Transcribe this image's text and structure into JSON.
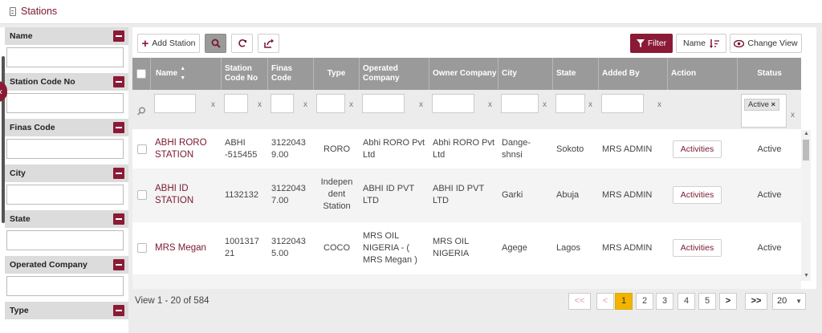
{
  "page": {
    "title": "Stations"
  },
  "sidebar": {
    "filters": [
      {
        "label": "Name"
      },
      {
        "label": "Station Code No"
      },
      {
        "label": "Finas Code"
      },
      {
        "label": "City"
      },
      {
        "label": "State"
      },
      {
        "label": "Operated Company"
      },
      {
        "label": "Type"
      }
    ]
  },
  "toolbar": {
    "add_label": "Add Station",
    "filter_label": "Filter",
    "sort_label": "Name",
    "view_label": "Change View"
  },
  "table": {
    "columns": [
      "Name",
      "Station Code No",
      "Finas Code",
      "Type",
      "Operated Company",
      "Owner Company",
      "City",
      "State",
      "Added By",
      "Action",
      "Status"
    ],
    "filter_clear": "x",
    "status_filter_chip": "Active",
    "rows": [
      {
        "name": "ABHI RORO STATION",
        "code": "ABHI -515455",
        "finas": "3122043 9.00",
        "type": "RORO",
        "operated": "Abhi RORO Pvt Ltd",
        "owner": "Abhi RORO Pvt Ltd",
        "city": "Dange-shnsi",
        "state": "Sokoto",
        "added_by": "MRS ADMIN",
        "action": "Activities",
        "status": "Active"
      },
      {
        "name": "ABHI ID STATION",
        "code": "1132132",
        "finas": "3122043 7.00",
        "type": "Indepen dent Station",
        "operated": "ABHI ID PVT LTD",
        "owner": "ABHI ID PVT LTD",
        "city": "Garki",
        "state": "Abuja",
        "added_by": "MRS ADMIN",
        "action": "Activities",
        "status": "Active"
      },
      {
        "name": "MRS Megan",
        "code": "1001317 21",
        "finas": "3122043 5.00",
        "type": "COCO",
        "operated": "MRS OIL NIGERIA - ( MRS Megan )",
        "owner": "MRS OIL NIGERIA",
        "city": "Agege",
        "state": "Lagos",
        "added_by": "MRS ADMIN",
        "action": "Activities",
        "status": "Active"
      }
    ]
  },
  "pagination": {
    "info": "View 1 - 20 of 584",
    "first": "<<",
    "prev": "<",
    "pages": [
      "1",
      "2",
      "3",
      "4",
      "5"
    ],
    "next": ">",
    "last": ">>",
    "page_size": "20"
  }
}
